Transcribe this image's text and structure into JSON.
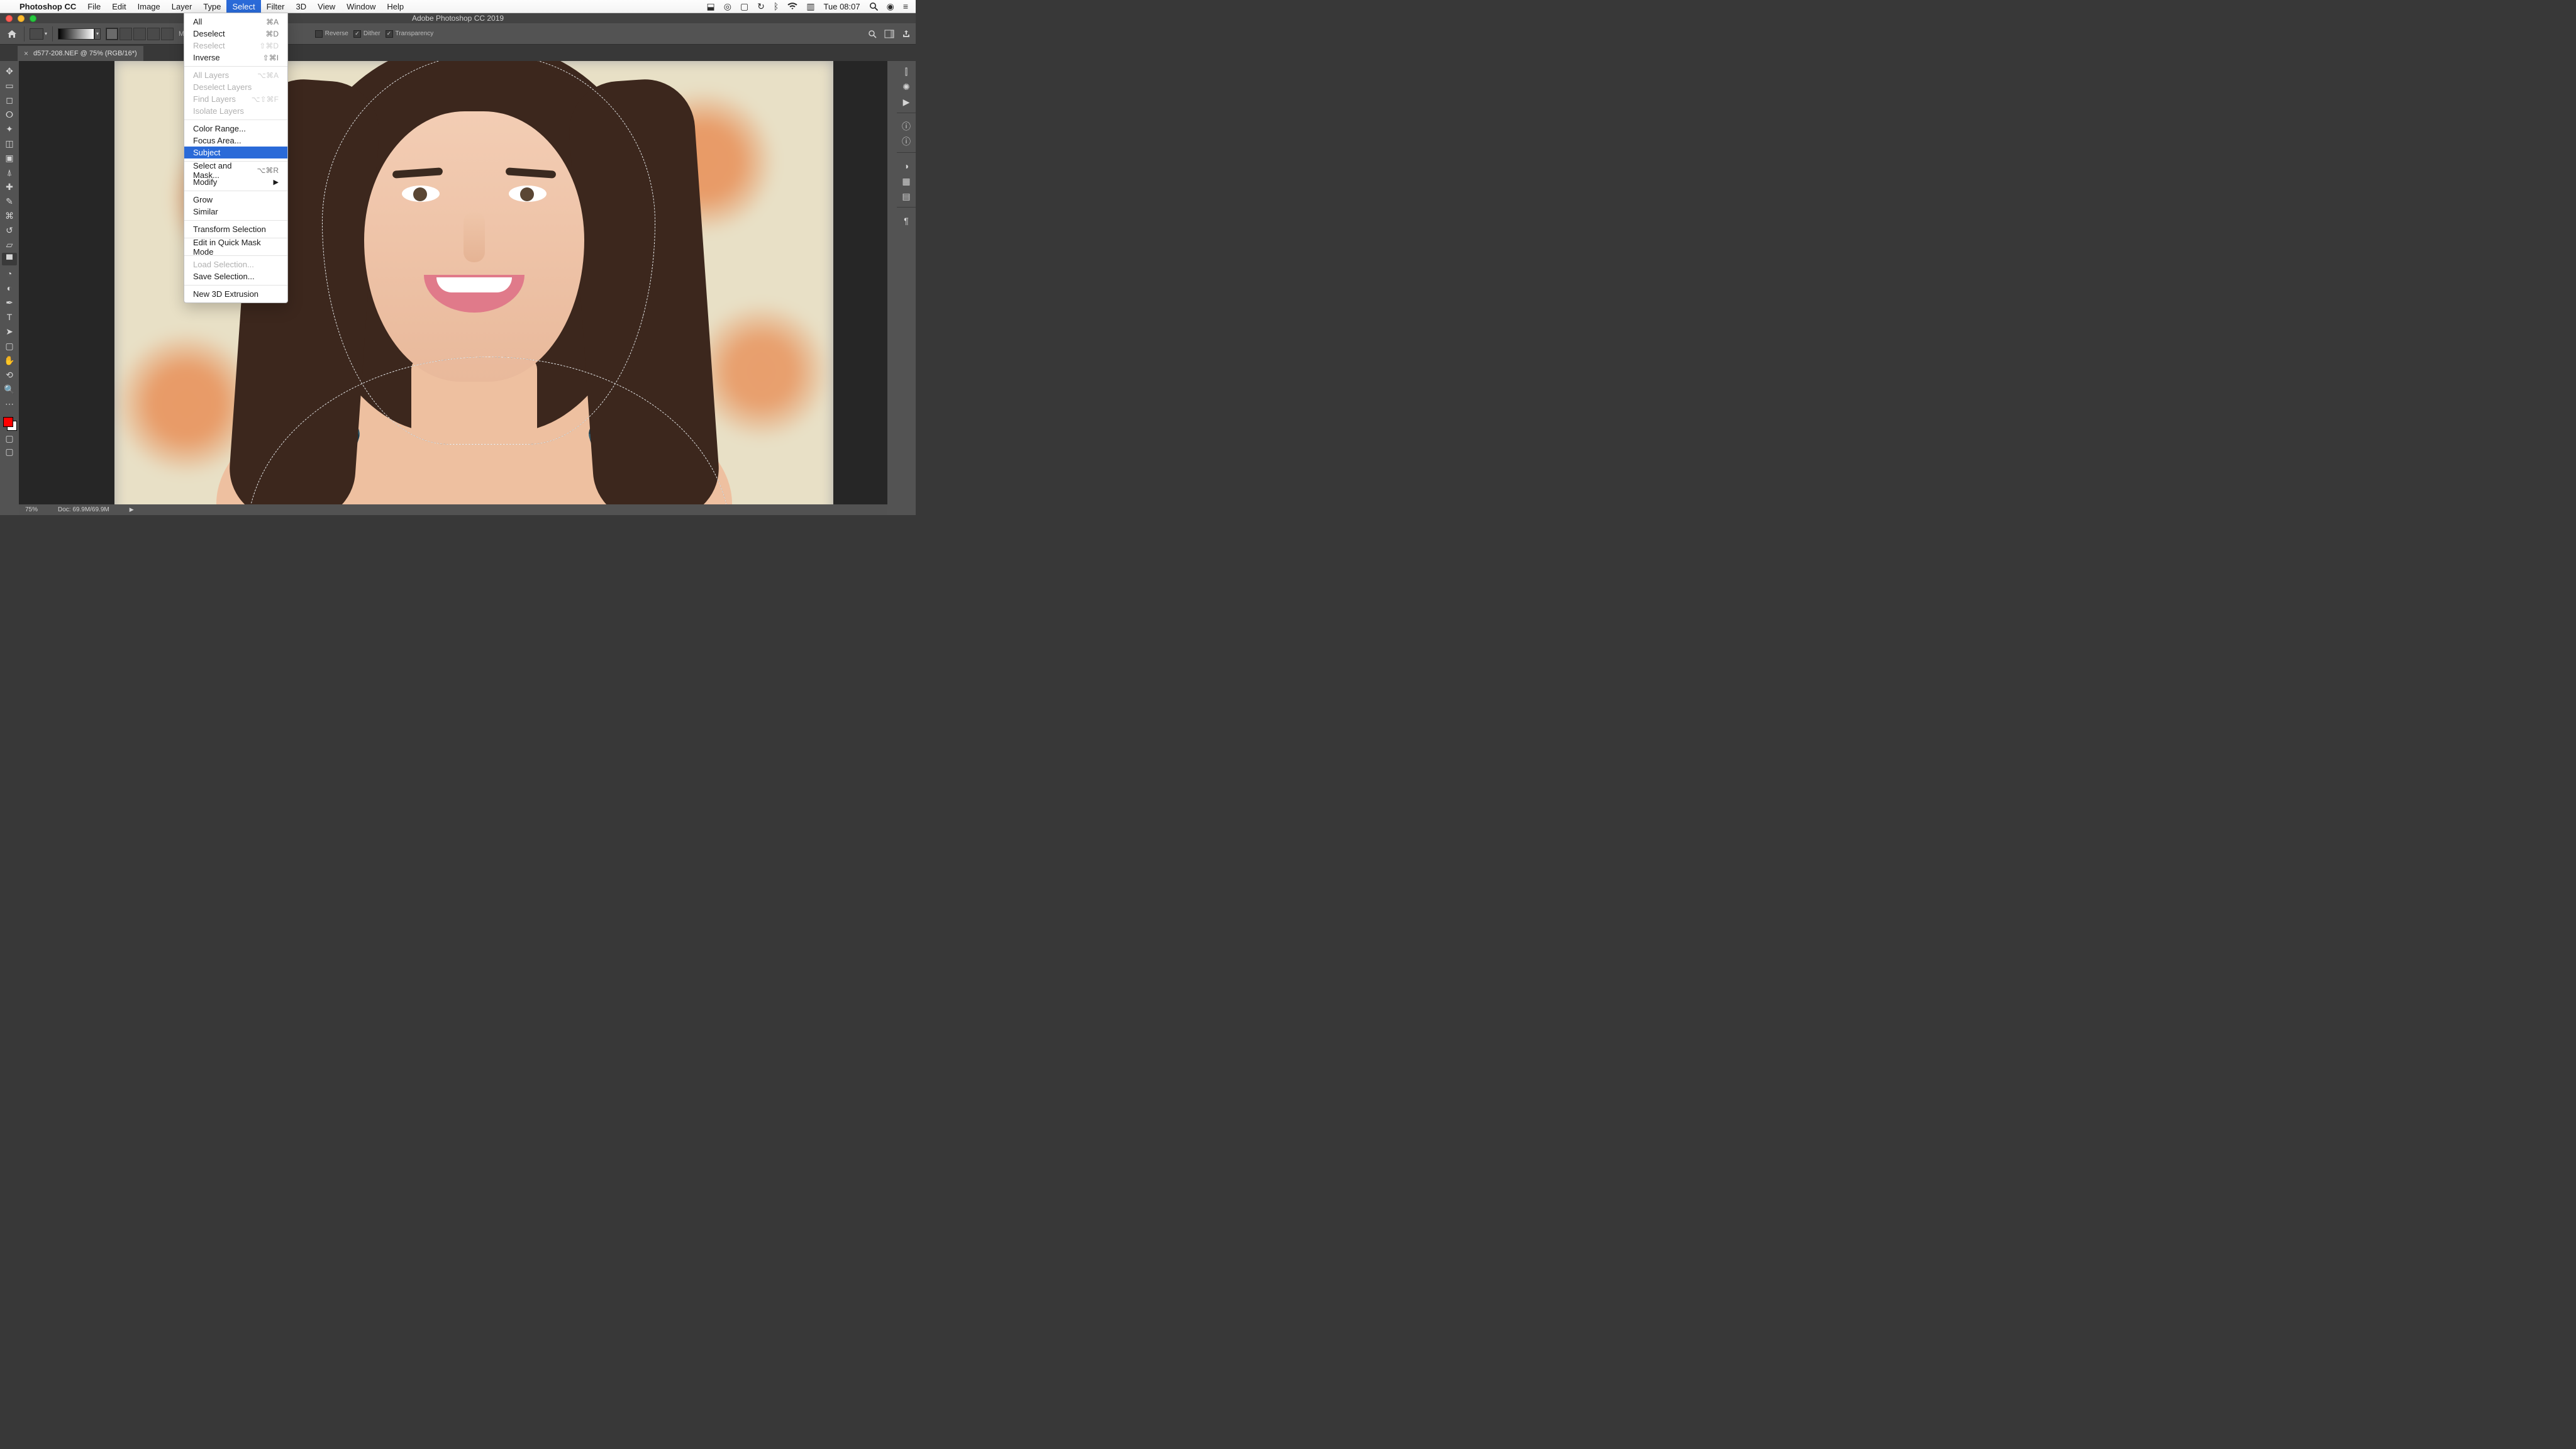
{
  "menubar": {
    "app_name": "Photoshop CC",
    "items": [
      "File",
      "Edit",
      "Image",
      "Layer",
      "Type",
      "Select",
      "Filter",
      "3D",
      "View",
      "Window",
      "Help"
    ],
    "selected_index": 5,
    "clock": "Tue 08:07"
  },
  "window": {
    "title": "Adobe Photoshop CC 2019"
  },
  "options": {
    "mode_label": "Mode:",
    "reverse": "Reverse",
    "dither": "Dither",
    "transparency": "Transparency"
  },
  "document_tab": {
    "label": "d577-208.NEF @ 75% (RGB/16*)"
  },
  "select_menu": {
    "items": [
      {
        "label": "All",
        "shortcut": "⌘A",
        "disabled": false
      },
      {
        "label": "Deselect",
        "shortcut": "⌘D",
        "disabled": false
      },
      {
        "label": "Reselect",
        "shortcut": "⇧⌘D",
        "disabled": true
      },
      {
        "label": "Inverse",
        "shortcut": "⇧⌘I",
        "disabled": false
      },
      {
        "divider": true
      },
      {
        "label": "All Layers",
        "shortcut": "⌥⌘A",
        "disabled": true
      },
      {
        "label": "Deselect Layers",
        "shortcut": "",
        "disabled": true
      },
      {
        "label": "Find Layers",
        "shortcut": "⌥⇧⌘F",
        "disabled": true
      },
      {
        "label": "Isolate Layers",
        "shortcut": "",
        "disabled": true
      },
      {
        "divider": true
      },
      {
        "label": "Color Range...",
        "shortcut": "",
        "disabled": false
      },
      {
        "label": "Focus Area...",
        "shortcut": "",
        "disabled": false
      },
      {
        "label": "Subject",
        "shortcut": "",
        "disabled": false,
        "highlight": true
      },
      {
        "divider": true
      },
      {
        "label": "Select and Mask...",
        "shortcut": "⌥⌘R",
        "disabled": false
      },
      {
        "label": "Modify",
        "shortcut": "",
        "disabled": false,
        "submenu": true
      },
      {
        "divider": true
      },
      {
        "label": "Grow",
        "shortcut": "",
        "disabled": false
      },
      {
        "label": "Similar",
        "shortcut": "",
        "disabled": false
      },
      {
        "divider": true
      },
      {
        "label": "Transform Selection",
        "shortcut": "",
        "disabled": false
      },
      {
        "divider": true
      },
      {
        "label": "Edit in Quick Mask Mode",
        "shortcut": "",
        "disabled": false
      },
      {
        "divider": true
      },
      {
        "label": "Load Selection...",
        "shortcut": "",
        "disabled": true
      },
      {
        "label": "Save Selection...",
        "shortcut": "",
        "disabled": false
      },
      {
        "divider": true
      },
      {
        "label": "New 3D Extrusion",
        "shortcut": "",
        "disabled": false
      }
    ]
  },
  "status": {
    "zoom": "75%",
    "doc": "Doc: 69.9M/69.9M"
  },
  "colors": {
    "highlight": "#2a6ad8",
    "foreground_swatch": "#ff0000"
  },
  "tools": [
    "move",
    "artboard",
    "marquee",
    "lasso",
    "quick-select",
    "crop",
    "frame",
    "eyedropper",
    "healing",
    "brush",
    "clone",
    "history-brush",
    "eraser",
    "gradient",
    "blur",
    "dodge",
    "pen",
    "type",
    "path-select",
    "rectangle",
    "hand",
    "rotate-view",
    "zoom"
  ],
  "right_panels": [
    "histogram",
    "adjustments",
    "actions",
    "properties",
    "info",
    "color",
    "swatches",
    "gradients",
    "character",
    "layers"
  ]
}
